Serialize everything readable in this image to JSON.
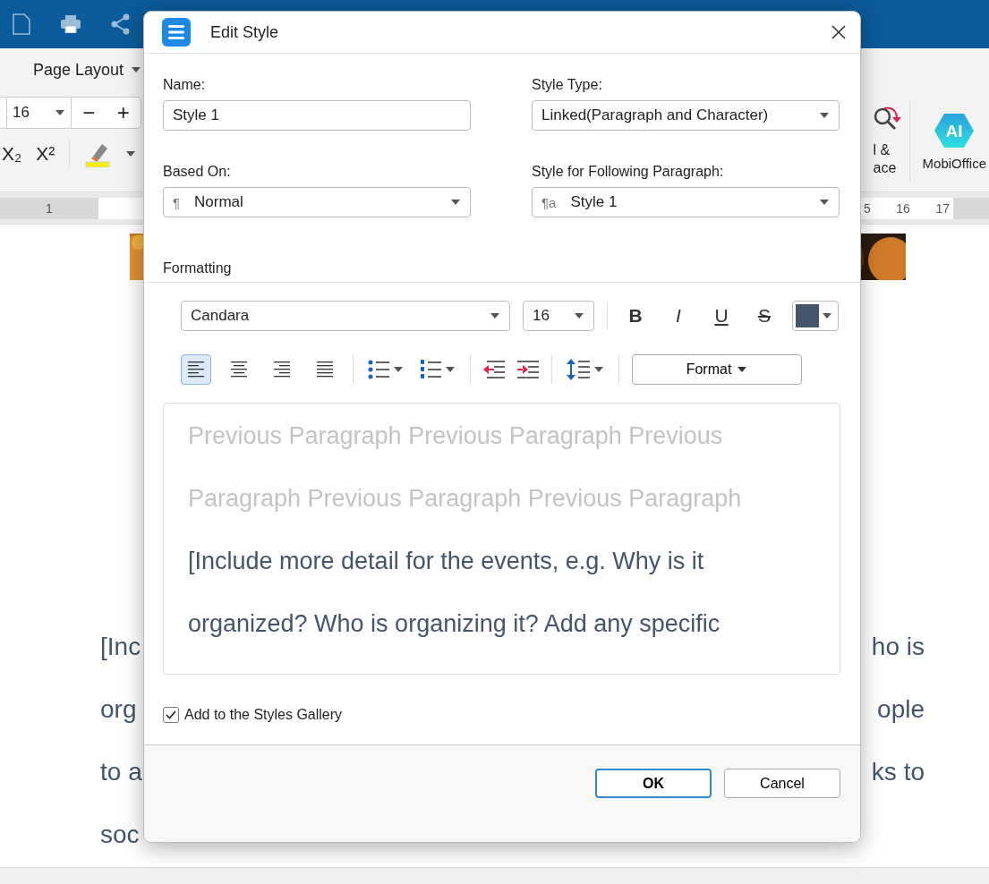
{
  "ribbon": {
    "tab": "Page Layout",
    "font_size": "16",
    "decrease": "−",
    "increase": "+",
    "subscript": "X₂",
    "superscript": "X²",
    "find_label_lines": [
      "l &",
      "ace"
    ],
    "ai_badge": "AI",
    "ai_label": "MobiOffice"
  },
  "ruler": {
    "left_marks": [
      "1"
    ],
    "right_marks": [
      "5",
      "16",
      "17"
    ]
  },
  "document": {
    "lines": [
      {
        "left": "[Inc",
        "right": "ho is"
      },
      {
        "left": "org",
        "right": "ople"
      },
      {
        "left": "to a",
        "right": "ks to"
      },
      {
        "left": "soc"
      }
    ]
  },
  "dialog": {
    "title": "Edit Style",
    "name": {
      "label": "Name:",
      "value": "Style 1"
    },
    "style_type": {
      "label": "Style Type:",
      "value": "Linked(Paragraph and Character)"
    },
    "based_on": {
      "label": "Based On:",
      "mark": "¶",
      "value": "Normal"
    },
    "following": {
      "label": "Style for Following Paragraph:",
      "mark": "¶a",
      "value": "Style 1"
    },
    "section": "Formatting",
    "font": "Candara",
    "size": "16",
    "bold": "B",
    "italic": "I",
    "underline": "U",
    "strike": "S",
    "font_color_swatch": {
      "color": "#44546a"
    },
    "alignments": [
      {
        "kind": "left",
        "selected": true
      },
      {
        "kind": "center",
        "selected": false
      },
      {
        "kind": "right",
        "selected": false
      },
      {
        "kind": "justify",
        "selected": false
      }
    ],
    "format_button": "Format",
    "preview_previous_lines": [
      "Previous Paragraph Previous Paragraph Previous",
      "Paragraph Previous Paragraph Previous Paragraph"
    ],
    "preview_sample_lines": [
      "[Include more detail for the events, e.g. Why is it",
      "organized? Who is organizing it? Add any specific"
    ],
    "add_to_gallery": {
      "label": "Add to the Styles Gallery",
      "checked": true
    },
    "buttons": [
      {
        "label": "OK",
        "kind": "default"
      },
      {
        "label": "Cancel",
        "kind": "normal"
      }
    ]
  }
}
